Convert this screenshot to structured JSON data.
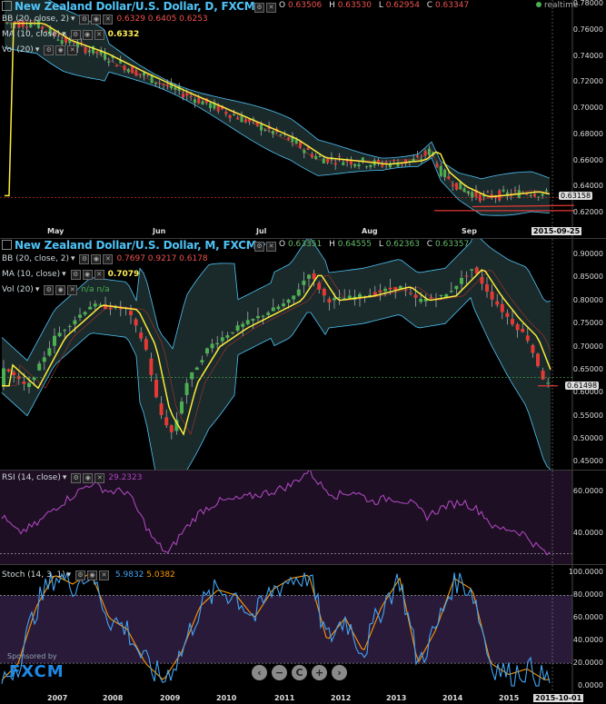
{
  "daily": {
    "title": "New Zealand Dollar/U.S. Dollar, D, FXCM",
    "ohlc": {
      "o_label": "O",
      "o": "0.63506",
      "h_label": "H",
      "h": "0.63530",
      "l_label": "L",
      "l": "0.62954",
      "c_label": "C",
      "c": "0.63347"
    },
    "bb": {
      "label": "BB (20, close, 2)",
      "values": "0.6329  0.6405  0.6253"
    },
    "ma": {
      "label": "MA (10, close)",
      "value": "0.6332"
    },
    "vol": {
      "label": "Vol (20)"
    },
    "realtime": "realtime",
    "price_ticks": [
      "0.78000",
      "0.76000",
      "0.74000",
      "0.72000",
      "0.70000",
      "0.68000",
      "0.66000",
      "0.64000",
      "0.62000"
    ],
    "current_price": "0.63158",
    "months": [
      "May",
      "Jun",
      "Jul",
      "Aug",
      "Sep"
    ],
    "date_tag": "2015-09-25"
  },
  "monthly": {
    "title": "New Zealand Dollar/U.S. Dollar, M, FXCM",
    "ohlc": {
      "o_label": "O",
      "o": "0.63351",
      "h_label": "H",
      "h": "0.64555",
      "l_label": "L",
      "l": "0.62363",
      "c_label": "C",
      "c": "0.63357"
    },
    "bb": {
      "label": "BB (20, close, 2)",
      "values": "0.7697  0.9217  0.6178"
    },
    "ma": {
      "label": "MA (10, close)",
      "value": "0.7079"
    },
    "vol": {
      "label": "Vol (20)",
      "values": "n/a  n/a"
    },
    "price_ticks": [
      "0.90000",
      "0.85000",
      "0.80000",
      "0.75000",
      "0.70000",
      "0.65000",
      "0.60000",
      "0.55000",
      "0.50000",
      "0.45000"
    ],
    "current_price": "0.61498",
    "years": [
      "2007",
      "2008",
      "2009",
      "2010",
      "2011",
      "2012",
      "2013",
      "2014",
      "2015"
    ],
    "date_tag": "2015-10-01"
  },
  "rsi": {
    "label": "RSI (14, close)",
    "value": "29.2323",
    "ticks": [
      "60.0000",
      "40.0000"
    ]
  },
  "stoch": {
    "label": "Stoch (14, 3, 1)",
    "k": "5.9832",
    "d": "5.0382",
    "ticks": [
      "100.0000",
      "80.0000",
      "60.0000",
      "40.0000",
      "20.0000",
      "0.0000"
    ]
  },
  "branding": {
    "sponsored": "Sponsored by",
    "logo": "FXCM"
  },
  "nav": [
    "‹",
    "−",
    "C",
    "+",
    "›"
  ],
  "colors": {
    "up": "#4caf50",
    "down": "#e53935",
    "ma": "#ffeb3b",
    "bb": "#4fc3f7",
    "rsi": "#ab47bc",
    "stoch_k": "#42a5f5",
    "stoch_d": "#ff9800"
  }
}
